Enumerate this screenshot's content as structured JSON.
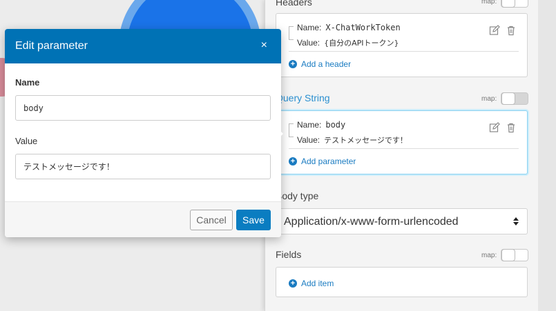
{
  "modal": {
    "title": "Edit parameter",
    "close_glyph": "×",
    "name_label": "Name",
    "name_value": "body",
    "value_label": "Value",
    "value_value": "テストメッセージです！",
    "cancel_label": "Cancel",
    "save_label": "Save"
  },
  "panel": {
    "headers_label": "Headers",
    "headers_item": {
      "name_key": "Name:",
      "name_value": "X-ChatWorkToken",
      "value_key": "Value:",
      "value_value": "{自分のAPIトークン}"
    },
    "add_header_label": "Add a header",
    "query_string_label": "Query String",
    "query_item": {
      "name_key": "Name:",
      "name_value": "body",
      "value_key": "Value:",
      "value_value": "テストメッセージです！"
    },
    "add_parameter_label": "Add parameter",
    "body_type_label": "Body type",
    "body_type_value": "Application/x-www-form-urlencoded",
    "fields_label": "Fields",
    "add_item_label": "Add item",
    "map_label": "map:"
  },
  "icons": [
    "edit-icon",
    "trash-icon",
    "plus-circle-icon",
    "close-icon",
    "select-arrows-icon"
  ],
  "colors": {
    "accent": "#0072b5",
    "link": "#1a7bc1",
    "query_label": "#2a8fd0",
    "active_border": "#8ad0f0"
  }
}
